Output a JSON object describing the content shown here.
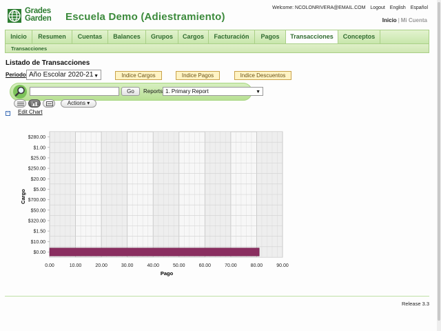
{
  "brand": {
    "logo_line1": "Grades",
    "logo_line2": "Garden",
    "app_title": "Escuela Demo (Adiestramiento)"
  },
  "top_links": {
    "welcome": "Welcome: NCOLONRIVERA@EMAIL.COM",
    "logout": "Logout",
    "english": "English",
    "espanol": "Español"
  },
  "nav_links": {
    "inicio": "Inicio",
    "separator": "|",
    "mi_cuenta": "Mi Cuenta"
  },
  "tabs": [
    {
      "label": "Inicio"
    },
    {
      "label": "Resumen"
    },
    {
      "label": "Cuentas"
    },
    {
      "label": "Balances"
    },
    {
      "label": "Grupos"
    },
    {
      "label": "Cargos"
    },
    {
      "label": "Facturación"
    },
    {
      "label": "Pagos"
    },
    {
      "label": "Transacciones",
      "active": true
    },
    {
      "label": "Conceptos"
    }
  ],
  "subnav": {
    "label": "Transacciones"
  },
  "page": {
    "heading": "Listado de Transacciones",
    "period_label": "Periodo",
    "period_value": "Año Escolar 2020-21",
    "btn_cargos": "Indice Cargos",
    "btn_pagos": "Indice Pagos",
    "btn_descuentos": "Indice Descuentos",
    "go": "Go",
    "reports_label": "Reports",
    "reports_value": "1. Primary Report",
    "actions": "Actions",
    "collapse": "−",
    "edit_chart": "Edit Chart"
  },
  "icons": {
    "search": "magnifier-icon",
    "list_view": "list-view-icon",
    "chart_view": "chart-view-icon",
    "detail_view": "detail-view-icon",
    "actions_caret": "caret-down-icon"
  },
  "colors": {
    "brand_green": "#3b8a3b",
    "tab_green": "#c8e6ac",
    "bar": "#8a2e60"
  },
  "chart_data": {
    "type": "bar",
    "orientation": "horizontal",
    "xlabel": "Pago",
    "ylabel": "Cargo",
    "xlim": [
      0,
      90
    ],
    "x_ticks": [
      "0.00",
      "10.00",
      "20.00",
      "30.00",
      "40.00",
      "50.00",
      "60.00",
      "70.00",
      "80.00",
      "90.00"
    ],
    "categories": [
      "$0.00",
      "$10.00",
      "$1.50",
      "$320.00",
      "$50.00",
      "$700.00",
      "$5.00",
      "$20.00",
      "$250.00",
      "$25.00",
      "$1.00",
      "$280.00"
    ],
    "values": [
      81,
      0,
      0,
      0,
      0,
      0,
      0,
      0,
      0,
      0,
      0,
      0
    ],
    "grid": true
  },
  "footer": {
    "release": "Release 3.3"
  }
}
